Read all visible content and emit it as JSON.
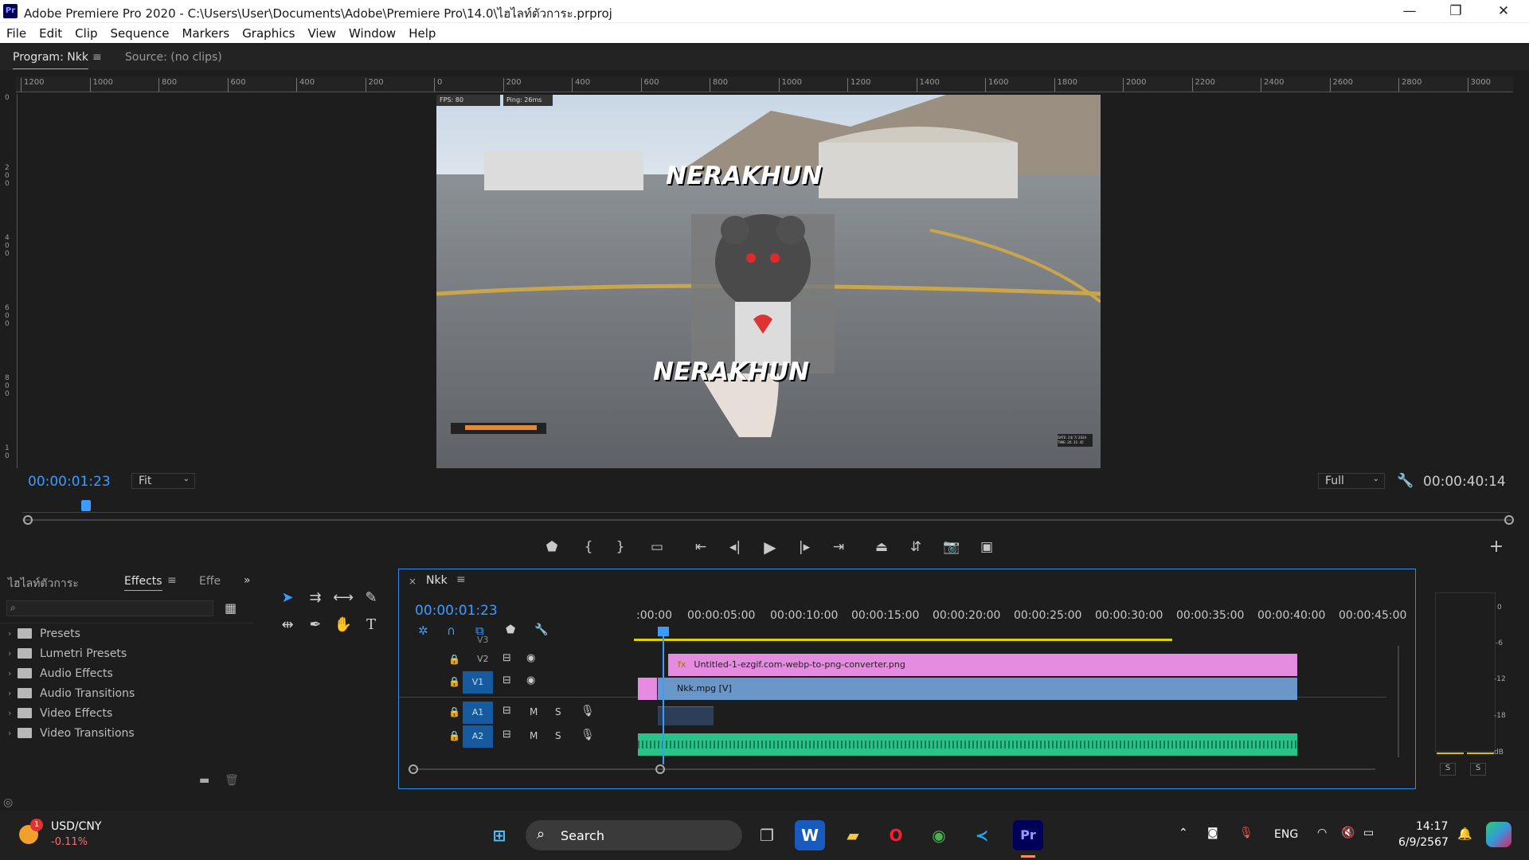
{
  "app": {
    "icon_label": "Pr",
    "title": "Adobe Premiere Pro 2020 - C:\\Users\\User\\Documents\\Adobe\\Premiere Pro\\14.0\\ไฮไลท์ตัวการะ.prproj"
  },
  "window_controls": {
    "minimize": "—",
    "maximize": "❐",
    "close": "✕"
  },
  "menu": [
    "File",
    "Edit",
    "Clip",
    "Sequence",
    "Markers",
    "Graphics",
    "View",
    "Window",
    "Help"
  ],
  "program": {
    "tab_label": "Program: Nkk",
    "source_label": "Source: (no clips)",
    "current_time": "00:00:01:23",
    "fit": "Fit",
    "quality": "Full",
    "duration": "00:00:40:14"
  },
  "ruler_ticks": [
    "1200",
    "1000",
    "800",
    "600",
    "400",
    "200",
    "0",
    "200",
    "400",
    "600",
    "800",
    "1000",
    "1200",
    "1400",
    "1600",
    "1800",
    "2000",
    "2200",
    "2400",
    "2600",
    "2800",
    "3000"
  ],
  "vruler_ticks": [
    "0",
    "2\n0\n0",
    "4\n0\n0",
    "6\n0\n0",
    "8\n0\n0",
    "1\n0"
  ],
  "video": {
    "fps": "FPS: 80",
    "ping": "Ping: 26ms",
    "overlay_text": "NERAKHUN",
    "hud_date": "DATE: 24/ 7/ 2024",
    "hud_time": "TIME: 20: 31: 45"
  },
  "transport": [
    "marker",
    "mark-in",
    "mark-out",
    "safe-margins",
    "go-to-in",
    "step-back",
    "play",
    "step-forward",
    "go-to-out",
    "lift",
    "extract",
    "export-frame",
    "compare"
  ],
  "effects_panel": {
    "project_tab": "ไฮไลท์ตัวการะ",
    "effects_tab": "Effects",
    "effe_tab": "Effe",
    "search_placeholder": "",
    "folders": [
      "Presets",
      "Lumetri Presets",
      "Audio Effects",
      "Audio Transitions",
      "Video Effects",
      "Video Transitions"
    ]
  },
  "timeline": {
    "tab": "Nkk",
    "current_time": "00:00:01:23",
    "ticks": [
      ":00:00",
      "00:00:05:00",
      "00:00:10:00",
      "00:00:15:00",
      "00:00:20:00",
      "00:00:25:00",
      "00:00:30:00",
      "00:00:35:00",
      "00:00:40:00",
      "00:00:45:00"
    ],
    "tracks": [
      {
        "id": "V3"
      },
      {
        "id": "V2"
      },
      {
        "id": "V1"
      },
      {
        "id": "A1",
        "m": "M",
        "s": "S"
      },
      {
        "id": "A2",
        "m": "M",
        "s": "S"
      }
    ],
    "clips": {
      "v2": "Untitled-1-ezgif.com-webp-to-png-converter.png",
      "v1": "Nkk.mpg [V]",
      "fx": "fx"
    }
  },
  "meters": {
    "scale": [
      "0",
      "-6",
      "-12",
      "-18",
      "dB"
    ],
    "solo_labels": [
      "S",
      "S"
    ]
  },
  "taskbar": {
    "widget_title": "USD/CNY",
    "widget_value": "-0.11%",
    "widget_badge": "1",
    "search": "Search",
    "lang": "ENG",
    "time": "14:17",
    "date": "6/9/2567"
  },
  "colors": {
    "accent": "#2d8ceb",
    "clip_v2": "#e58ce0",
    "clip_v1": "#6b96c8",
    "audio": "#29c28a",
    "track_blue": "#165aa0"
  }
}
